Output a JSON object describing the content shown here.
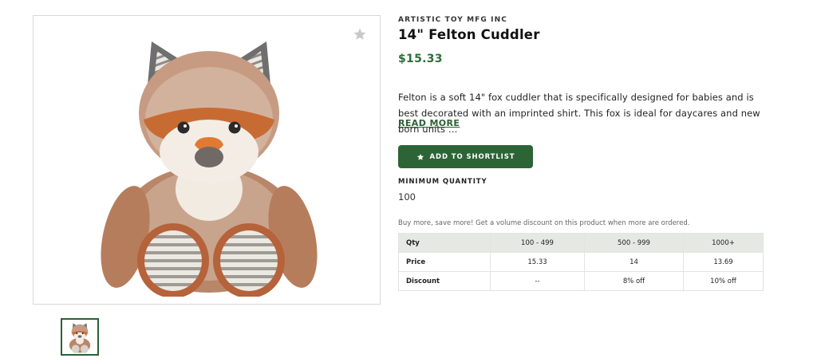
{
  "product": {
    "brand": "ARTISTIC TOY MFG INC",
    "title": "14\" Felton Cuddler",
    "price": "$15.33",
    "description": "Felton is a soft 14\" fox cuddler that is specifically designed for babies and is best decorated with an imprinted shirt. This fox is ideal for daycares and new born units …",
    "read_more_label": "READ MORE",
    "shortlist_label": "ADD TO SHORTLIST",
    "min_quantity_label": "MINIMUM QUANTITY",
    "min_quantity_value": "100",
    "volume_note": "Buy more, save more! Get a volume discount on this product when more are ordered."
  },
  "pricing_table": {
    "header": [
      "Qty",
      "100 - 499",
      "500 - 999",
      "1000+"
    ],
    "rows": [
      [
        "Price",
        "15.33",
        "14",
        "13.69"
      ],
      [
        "Discount",
        "--",
        "8% off",
        "10% off"
      ]
    ]
  },
  "icons": {
    "favorite": "star-icon",
    "button_icon": "star-icon"
  },
  "colors": {
    "accent": "#2c6436",
    "price": "#2c6e37",
    "table_header_bg": "#e6e8e4"
  }
}
